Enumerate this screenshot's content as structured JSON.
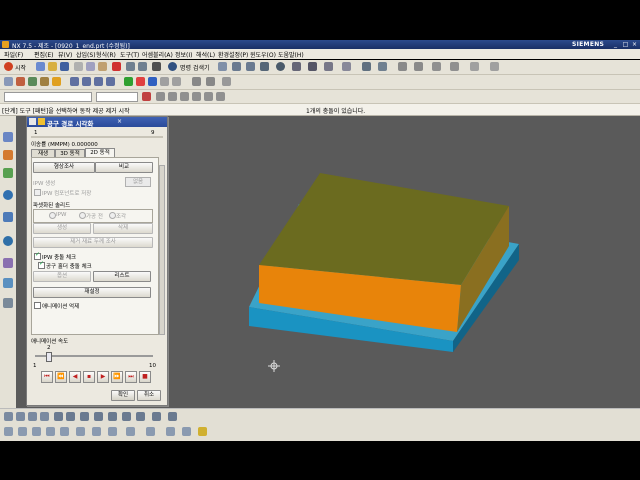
{
  "window": {
    "title": "NX 7.5 - 제조 - [0920_1_end.prt (수정됨)]",
    "brand": "SIEMENS",
    "controls": [
      "_",
      "□",
      "×"
    ]
  },
  "menu": {
    "items": [
      "파일(F)",
      "편집(E)",
      "뷰(V)",
      "삽입(S)",
      "형식(R)",
      "도구(T)",
      "어셈블리(A)",
      "정보(I)",
      "해석(L)",
      "환경설정(P)",
      "윈도우(O)",
      "도움말(H)"
    ]
  },
  "toolbar": {
    "start_label": "시작",
    "view_label": "명령 검색기"
  },
  "status": {
    "left": "[단계] 도구 [패턴]을 선택하여 동작 제공 제거 시작",
    "center": "1개의 충돌이 있습니다."
  },
  "dialog": {
    "title": "공구 경로 시각화",
    "counter_left": "1",
    "counter_right": "9",
    "feed_label": "이송률 (MMPM) 0.000000",
    "tabs": [
      "재생",
      "3D 동적",
      "2D 동적"
    ],
    "active_tab": 2,
    "btn_generate": "형상조사",
    "btn_compare": "비교",
    "ipw_label": "IPW 생성",
    "ipw_value": "없음",
    "ipw_saved": "IPW 컴포넌트로 저장",
    "section_label": "파셋화된 솔리드",
    "radio_options": [
      "IPW",
      "가공 전",
      "조각"
    ],
    "btn_create": "생성",
    "btn_delete": "삭제",
    "btn_remove_fill": "제거 재료 두께 조사",
    "collision_check": "IPW 충돌 체크",
    "tool_check": "공구 홀더 충돌 체크",
    "btn_options": "옵션",
    "btn_list": "리스트",
    "btn_reset": "재설정",
    "animate_label": "애니메이션 억제",
    "speed_label": "애니메이션 속도",
    "speed_value": "2",
    "speed_min": "1",
    "speed_max": "10",
    "speed_fraction": 0.11,
    "ok": "확인",
    "cancel": "취소"
  },
  "colors": {
    "viewport_bg": "#5a5a5a",
    "part_top": "#6b6b1f",
    "part_front": "#e8840a",
    "part_side": "#8a6f20",
    "base_top": "#3aa3c8",
    "base_front": "#1a93c2",
    "base_side": "#116488"
  }
}
